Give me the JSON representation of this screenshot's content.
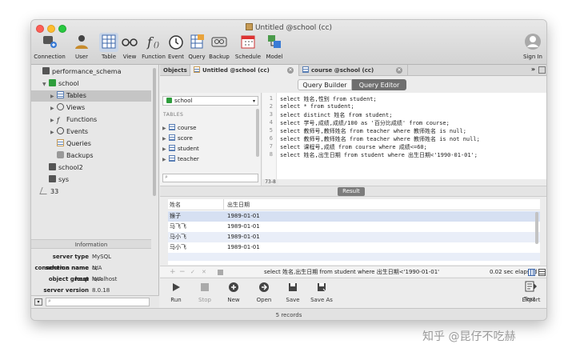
{
  "window": {
    "title": "Untitled @school (cc)"
  },
  "toolbar": {
    "items": [
      {
        "label": "Connection"
      },
      {
        "label": "User"
      },
      {
        "label": "Table"
      },
      {
        "label": "View"
      },
      {
        "label": "Function"
      },
      {
        "label": "Event"
      },
      {
        "label": "Query"
      },
      {
        "label": "Backup"
      },
      {
        "label": "Schedule"
      },
      {
        "label": "Model"
      }
    ],
    "signin_label": "Sign In"
  },
  "sidebar": {
    "tree": [
      {
        "label": "performance_schema"
      },
      {
        "label": "school"
      },
      {
        "label": "Tables"
      },
      {
        "label": "Views"
      },
      {
        "label": "Functions"
      },
      {
        "label": "Events"
      },
      {
        "label": "Queries"
      },
      {
        "label": "Backups"
      },
      {
        "label": "school2"
      },
      {
        "label": "sys"
      },
      {
        "label": "33"
      }
    ],
    "info_header": "Information",
    "info": [
      {
        "key": "server type",
        "value": "MySQL"
      },
      {
        "key": "connection name",
        "value": "cc"
      },
      {
        "key": "host",
        "value": "localhost"
      },
      {
        "key": "server version",
        "value": "8.0.18"
      },
      {
        "key": "database name",
        "value": "school"
      },
      {
        "key": "schema name",
        "value": "N/A"
      },
      {
        "key": "object group",
        "value": "N/A"
      }
    ]
  },
  "tabs": {
    "objects": "Objects",
    "tab1": "Untitled @school (cc)",
    "tab2": "course @school (cc)"
  },
  "segment": {
    "builder": "Query Builder",
    "editor": "Query Editor"
  },
  "schema_pane": {
    "db_select": "school",
    "tables_header": "TABLES",
    "tables": [
      "course",
      "score",
      "student",
      "teacher"
    ],
    "count": "73-8"
  },
  "editor": {
    "lines": [
      "select 姓名,性别 from student;",
      "select * from student;",
      "select distinct 姓名 from student;",
      "select 学号,成绩,成绩/100 as '百分比成绩' from course;",
      "select 教师号,教师姓名 from teacher where 教师姓名 is null;",
      "select 教师号,教师姓名 from teacher where 教师姓名 is not null;",
      "select 课程号,成绩 from course where 成绩<=60;",
      "select 姓名,出生日期 from student where 出生日期<'1990-01-01';"
    ]
  },
  "result": {
    "button": "Result",
    "columns": [
      "姓名",
      "出生日期"
    ],
    "rows": [
      [
        "猴子",
        "1989-01-01"
      ],
      [
        "马飞飞",
        "1989-01-01"
      ],
      [
        "马小飞",
        "1989-01-01"
      ],
      [
        "马小飞",
        "1989-01-01"
      ]
    ],
    "status_sql": "select 姓名,出生日期 from student where 出生日期<'1990-01-01'",
    "elapsed": "0.02 sec elapsed"
  },
  "bottom_tools": [
    {
      "label": "Run"
    },
    {
      "label": "Stop"
    },
    {
      "label": "New"
    },
    {
      "label": "Open"
    },
    {
      "label": "Save"
    },
    {
      "label": "Save As"
    },
    {
      "label": "Export"
    },
    {
      "label": "Text"
    }
  ],
  "footer": {
    "records": "5 records"
  },
  "watermark": "知乎 @昆仔不吃赫"
}
